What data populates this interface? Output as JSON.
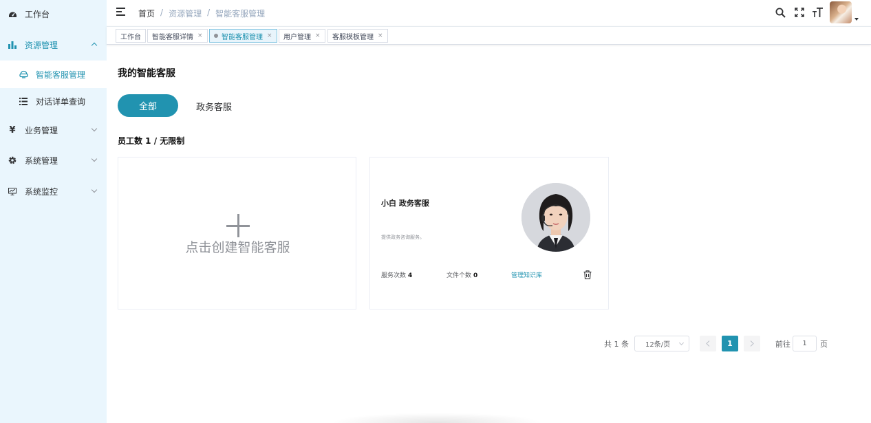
{
  "sidebar": {
    "items": [
      {
        "label": "工作台",
        "icon": "dashboard-icon"
      },
      {
        "label": "资源管理",
        "icon": "bar-chart-icon",
        "expanded": true,
        "children": [
          {
            "label": "智能客服管理",
            "icon": "bot-icon",
            "active": true
          },
          {
            "label": "对话详单查询",
            "icon": "list-icon"
          }
        ]
      },
      {
        "label": "业务管理",
        "icon": "yen-icon"
      },
      {
        "label": "系统管理",
        "icon": "gear-icon"
      },
      {
        "label": "系统监控",
        "icon": "monitor-icon"
      }
    ]
  },
  "header": {
    "breadcrumb": [
      "首页",
      "资源管理",
      "智能客服管理"
    ],
    "separator": "/"
  },
  "tags": [
    {
      "label": "工作台",
      "closable": false
    },
    {
      "label": "智能客服详情",
      "closable": true
    },
    {
      "label": "智能客服管理",
      "closable": true,
      "active": true
    },
    {
      "label": "用户管理",
      "closable": true
    },
    {
      "label": "客服模板管理",
      "closable": true
    }
  ],
  "tag_close": "×",
  "main": {
    "title": "我的智能客服",
    "filters": {
      "all": "全部",
      "gov": "政务客服"
    },
    "staff_count": "员工数 1 / 无限制",
    "create_label": "点击创建智能客服",
    "bot": {
      "name": "小白  政务客服",
      "description": "提供政务咨询服务。",
      "service_count_label": "服务次数",
      "service_count": "4",
      "file_count_label": "文件个数",
      "file_count": "0",
      "kb_link": "管理知识库"
    }
  },
  "pagination": {
    "total": "共 1 条",
    "page_size": "12条/页",
    "current": "1",
    "goto_label": "前往",
    "goto_value": "1",
    "page_suffix": "页"
  },
  "colors": {
    "accent": "#2193b0",
    "sidebar_bg": "#eaf6fd"
  }
}
